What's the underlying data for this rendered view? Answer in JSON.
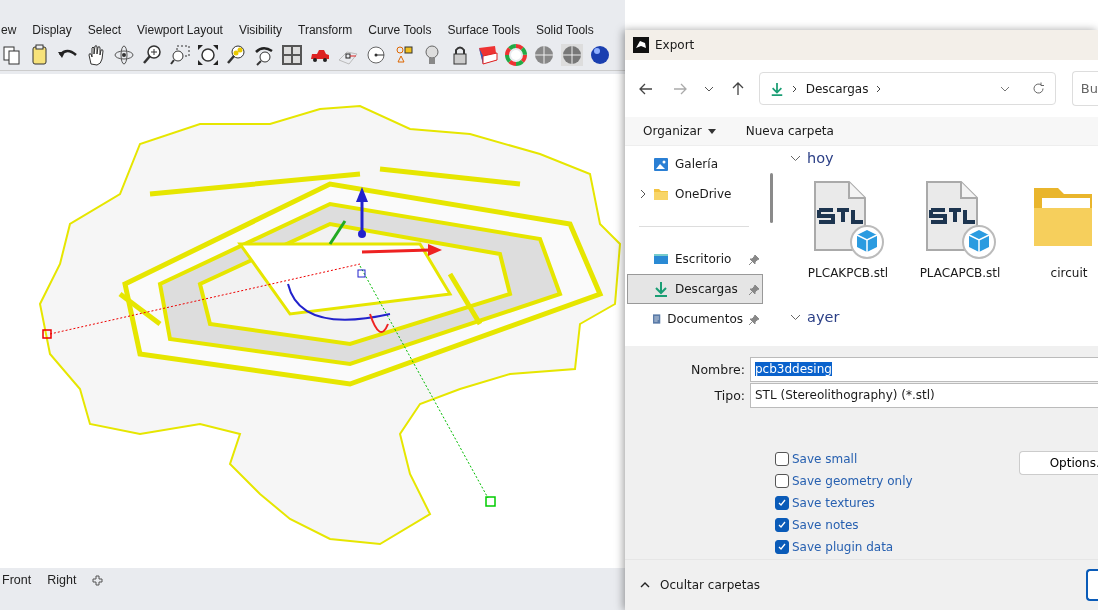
{
  "menu_tabs": [
    "ew",
    "Display",
    "Select",
    "Viewport Layout",
    "Visibility",
    "Transform",
    "Curve Tools",
    "Surface Tools",
    "Solid Tools"
  ],
  "viewport_tabs": [
    "Front",
    "Right"
  ],
  "dialog": {
    "title": "Export",
    "breadcrumb": "Descargas",
    "search_placeholder": "Bu",
    "toolbar": [
      "Organizar",
      "Nueva carpeta"
    ],
    "sidebar": [
      {
        "label": "Galería",
        "kind": "gallery",
        "expandable": false,
        "pinned": false,
        "selected": false
      },
      {
        "label": "OneDrive",
        "kind": "folder",
        "expandable": true,
        "pinned": false,
        "selected": false
      },
      {
        "label": "Escritorio",
        "kind": "desktop",
        "expandable": false,
        "pinned": true,
        "selected": false
      },
      {
        "label": "Descargas",
        "kind": "download",
        "expandable": false,
        "pinned": true,
        "selected": true
      },
      {
        "label": "Documentos",
        "kind": "document",
        "expandable": false,
        "pinned": true,
        "selected": false
      }
    ],
    "groups": [
      {
        "label": "hoy",
        "files": [
          {
            "name": "PLCAKPCB.stl",
            "kind": "stl"
          },
          {
            "name": "PLACAPCB.stl",
            "kind": "stl"
          },
          {
            "name": "circuit",
            "kind": "folder"
          }
        ]
      },
      {
        "label": "ayer"
      }
    ],
    "fields": [
      {
        "label": "Nombre:",
        "value": "pcb3ddesing",
        "selected": true
      },
      {
        "label": "Tipo:",
        "value": "STL (Stereolithography) (*.stl)",
        "selected": false
      }
    ],
    "options": [
      {
        "label": "Save small",
        "checked": false
      },
      {
        "label": "Save geometry only",
        "checked": false
      },
      {
        "label": "Save textures",
        "checked": true
      },
      {
        "label": "Save notes",
        "checked": true
      },
      {
        "label": "Save plugin data",
        "checked": true
      }
    ],
    "options_button": "Options.",
    "footer": "Ocultar carpetas"
  }
}
